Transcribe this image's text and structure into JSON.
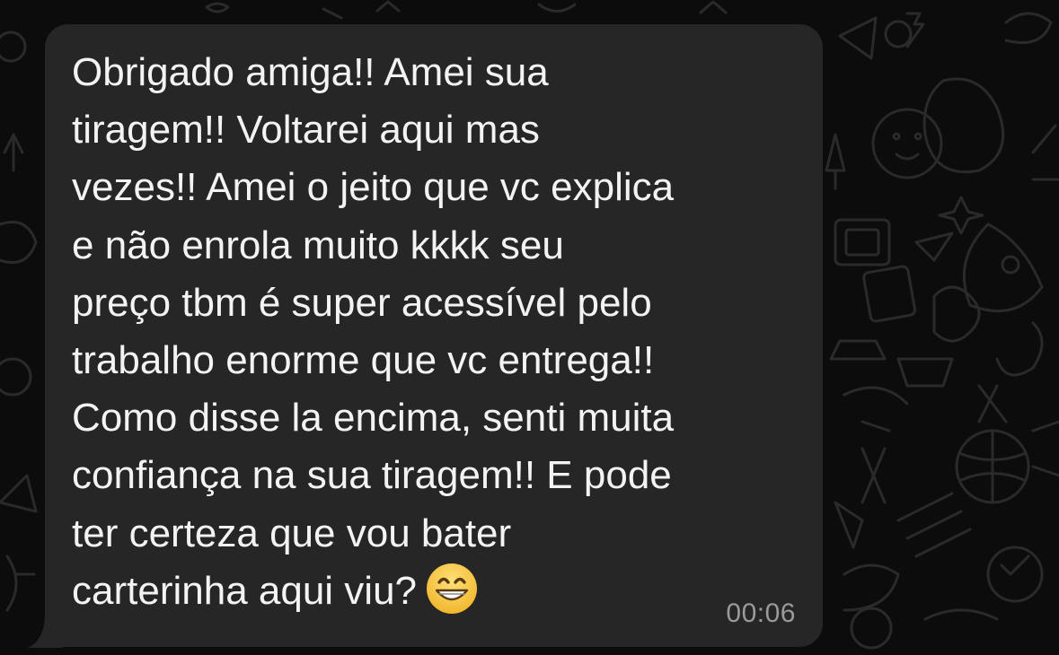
{
  "message": {
    "lines": [
      "Obrigado amiga!! Amei sua",
      "tiragem!! Voltarei aqui mas",
      "vezes!! Amei o jeito que vc explica",
      "e não enrola muito kkkk seu",
      "preço tbm é super acessível pelo",
      "trabalho enorme que vc entrega!!",
      "Como disse la encima, senti muita",
      "confiança na sua tiragem!! E pode",
      "ter certeza que vou bater",
      "carterinha aqui viu?"
    ],
    "emoji": "grinning-face-with-smiling-eyes",
    "timestamp": "00:06"
  },
  "colors": {
    "background": "#0c0c0c",
    "bubble": "#262626",
    "text": "#f3f3f3",
    "timestamp": "#9a9a9a",
    "emoji_face": "#f7c53a"
  }
}
